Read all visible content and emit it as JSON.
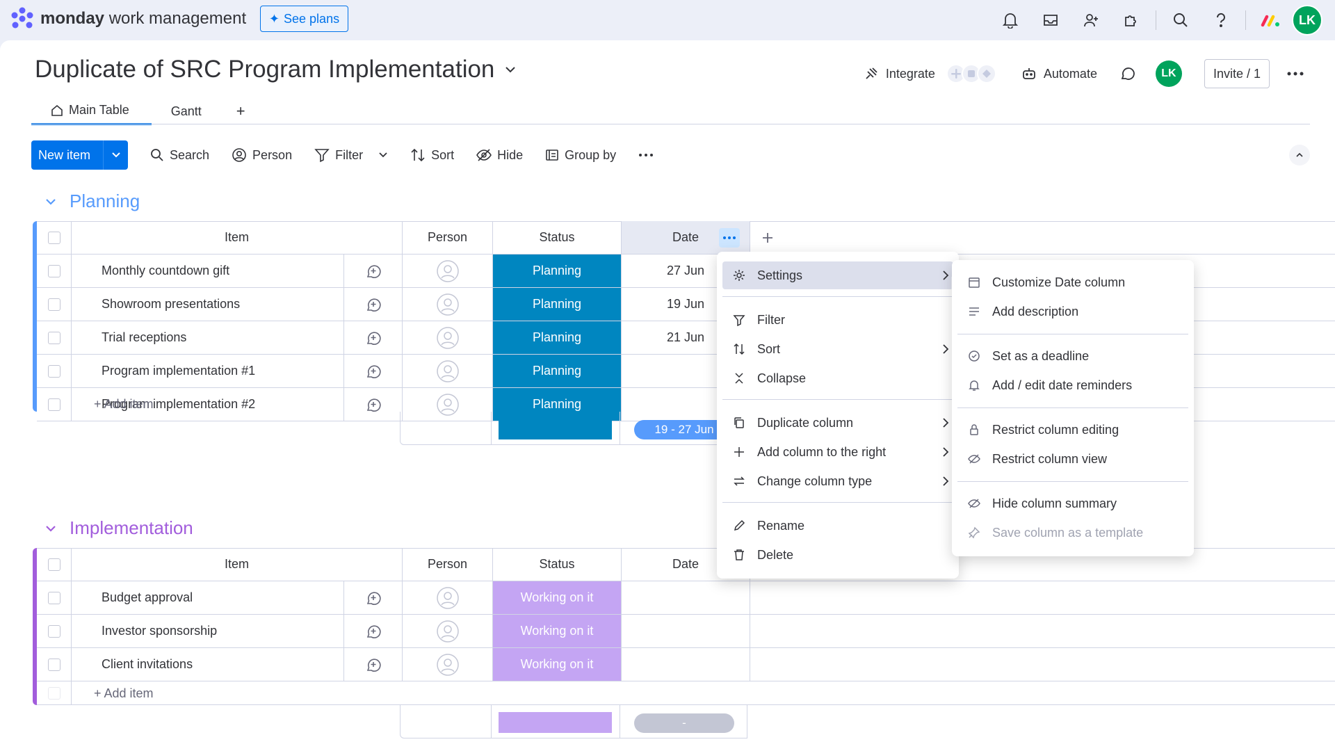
{
  "topbar": {
    "brand": "monday",
    "product": "work management",
    "see_plans": "See plans",
    "avatar_initials": "LK"
  },
  "board": {
    "title": "Duplicate of SRC Program Implementation",
    "integrate": "Integrate",
    "automate": "Automate",
    "avatar_initials": "LK",
    "invite": "Invite / 1"
  },
  "tabs": [
    {
      "label": "Main Table"
    },
    {
      "label": "Gantt"
    },
    {
      "label": "+"
    }
  ],
  "toolbar": {
    "new_item": "New item",
    "search": "Search",
    "person": "Person",
    "filter": "Filter",
    "sort": "Sort",
    "hide": "Hide",
    "group_by": "Group by"
  },
  "columns": {
    "item": "Item",
    "person": "Person",
    "status": "Status",
    "date": "Date"
  },
  "groups": [
    {
      "title": "Planning",
      "color": "#579bfc",
      "rows": [
        {
          "item": "Monthly countdown gift",
          "status": "Planning",
          "date": "27 Jun"
        },
        {
          "item": "Showroom presentations",
          "status": "Planning",
          "date": "19 Jun"
        },
        {
          "item": "Trial receptions",
          "status": "Planning",
          "date": "21 Jun"
        },
        {
          "item": "Program implementation #1",
          "status": "Planning",
          "date": ""
        },
        {
          "item": "Program implementation #2",
          "status": "Planning",
          "date": ""
        }
      ],
      "status_color": "#0086c0",
      "add_item": "+ Add item",
      "date_summary": "19 - 27 Jun"
    },
    {
      "title": "Implementation",
      "color": "#a25ddc",
      "rows": [
        {
          "item": "Budget approval",
          "status": "Working on it",
          "date": ""
        },
        {
          "item": "Investor sponsorship",
          "status": "Working on it",
          "date": ""
        },
        {
          "item": "Client invitations",
          "status": "Working on it",
          "date": ""
        }
      ],
      "status_color": "#c4a5f3",
      "add_item": "+ Add item",
      "date_summary": "-"
    }
  ],
  "column_menu": {
    "settings": "Settings",
    "filter": "Filter",
    "sort": "Sort",
    "collapse": "Collapse",
    "duplicate_column": "Duplicate column",
    "add_column_right": "Add column to the right",
    "change_column_type": "Change column type",
    "rename": "Rename",
    "delete": "Delete"
  },
  "settings_submenu": {
    "customize": "Customize Date column",
    "add_description": "Add description",
    "set_deadline": "Set as a deadline",
    "reminders": "Add / edit date reminders",
    "restrict_editing": "Restrict column editing",
    "restrict_view": "Restrict column view",
    "hide_summary": "Hide column summary",
    "save_template": "Save column as a template"
  }
}
